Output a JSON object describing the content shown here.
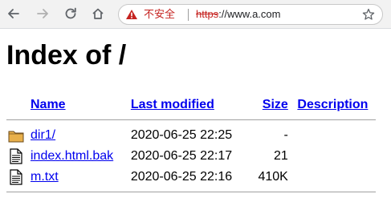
{
  "browser": {
    "security_label": "不安全",
    "url_scheme": "https",
    "url_rest": "://www.a.com"
  },
  "page": {
    "title": "Index of /",
    "columns": {
      "name": "Name",
      "last_modified": "Last modified",
      "size": "Size",
      "description": "Description"
    },
    "entries": [
      {
        "icon": "folder-icon",
        "name": "dir1/",
        "modified": "2020-06-25 22:25",
        "size": "-",
        "description": ""
      },
      {
        "icon": "file-icon",
        "name": "index.html.bak",
        "modified": "2020-06-25 22:17",
        "size": "21",
        "description": ""
      },
      {
        "icon": "file-icon",
        "name": "m.txt",
        "modified": "2020-06-25 22:16",
        "size": "410K",
        "description": ""
      }
    ]
  },
  "colors": {
    "link": "#0000ee",
    "insecure": "#c5221f",
    "toolbar": "#f2f2f2"
  }
}
